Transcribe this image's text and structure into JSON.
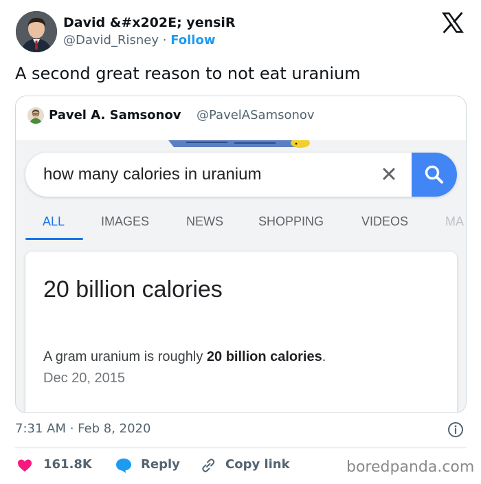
{
  "author": {
    "name": "David &#x202E; yensiR",
    "handle": "@David_Risney",
    "separator": "·",
    "follow_label": "Follow"
  },
  "tweet_text": "A second great reason to not eat uranium",
  "quoted_tweet": {
    "name": "Pavel A. Samsonov",
    "handle": "@PavelASamsonov",
    "screenshot": {
      "search_query": "how many calories in uranium",
      "tabs": [
        "ALL",
        "IMAGES",
        "NEWS",
        "SHOPPING",
        "VIDEOS",
        "MA"
      ],
      "active_tab": "ALL",
      "result_title": "20 billion calories",
      "result_desc_prefix": "A gram uranium is roughly ",
      "result_desc_bold": "20 billion calories",
      "result_desc_suffix": ".",
      "result_date": "Dec 20, 2015"
    }
  },
  "timestamp": "7:31 AM · Feb 8, 2020",
  "actions": {
    "likes_count": "161.8K",
    "reply_label": "Reply",
    "copy_link_label": "Copy link"
  },
  "watermark": "boredpanda.com",
  "colors": {
    "follow_blue": "#1d9bf0",
    "like_red": "#f91880",
    "reply_blue": "#1d9bf0",
    "google_blue": "#4285f4",
    "tab_active": "#1a73e8"
  },
  "icons": [
    "x-logo-icon",
    "clear-icon",
    "magnifier-icon",
    "info-icon",
    "heart-icon",
    "speech-bubble-icon",
    "link-icon"
  ]
}
